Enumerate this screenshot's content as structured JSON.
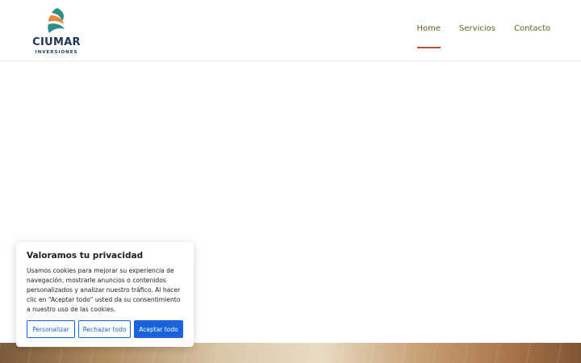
{
  "brand": {
    "name": "CIUMAR",
    "tagline": "INVERSIONES",
    "colors": {
      "teal": "#2a8f8a",
      "orange": "#e58a3c",
      "navy": "#1d3557"
    }
  },
  "nav": {
    "items": [
      {
        "label": "Home",
        "active": true
      },
      {
        "label": "Servicios",
        "active": false
      },
      {
        "label": "Contacto",
        "active": false
      }
    ],
    "accent": "#b4553a",
    "text_color": "#6b6320"
  },
  "cookie": {
    "title": "Valoramos tu privacidad",
    "body": "Usamos cookies para mejorar su experiencia de navegación, mostrarle anuncios o contenidos personalizados y analizar nuestro tráfico. Al hacer clic en “Aceptar todo” usted da su consentimiento a nuestro uso de las cookies.",
    "buttons": {
      "customize": "Personalizar",
      "reject": "Rechazar todo",
      "accept": "Aceptar todo"
    },
    "accent": "#1863dc"
  }
}
